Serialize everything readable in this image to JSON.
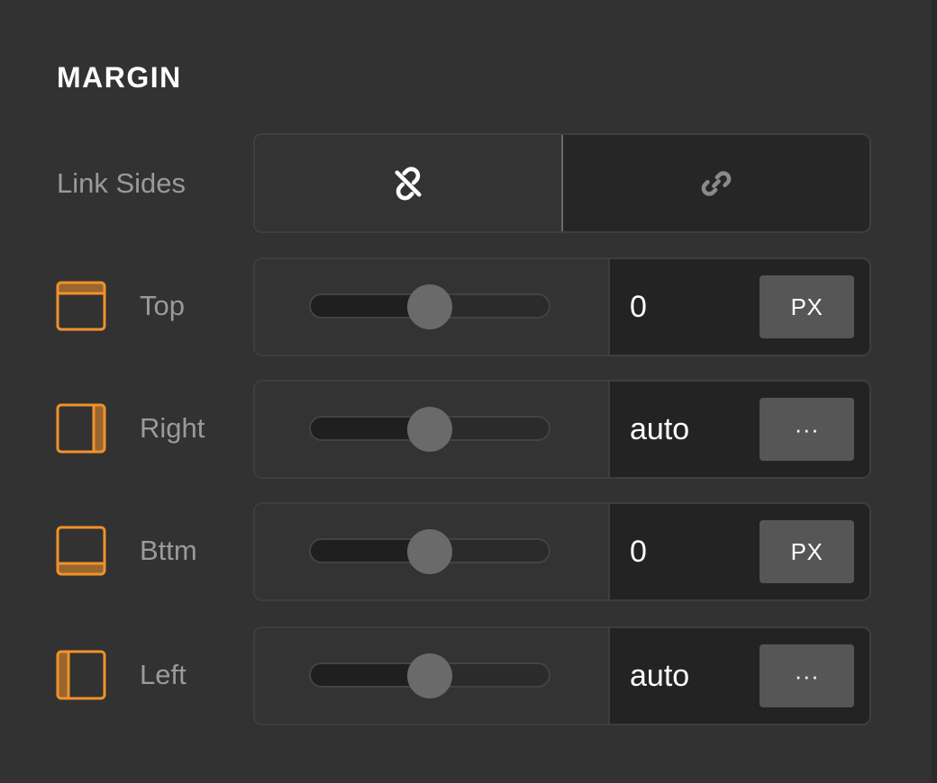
{
  "section": {
    "title": "MARGIN"
  },
  "link_sides": {
    "label": "Link Sides",
    "options": [
      {
        "icon": "unlink-icon",
        "active": true
      },
      {
        "icon": "link-icon",
        "active": false
      }
    ]
  },
  "sides": [
    {
      "key": "top",
      "label": "Top",
      "icon": "margin-top-icon",
      "value": "0",
      "unit": "PX",
      "slider": 0.5
    },
    {
      "key": "right",
      "label": "Right",
      "icon": "margin-right-icon",
      "value": "auto",
      "unit": "···",
      "slider": 0.5
    },
    {
      "key": "bottom",
      "label": "Bttm",
      "icon": "margin-bottom-icon",
      "value": "0",
      "unit": "PX",
      "slider": 0.5
    },
    {
      "key": "left",
      "label": "Left",
      "icon": "margin-left-icon",
      "value": "auto",
      "unit": "···",
      "slider": 0.5
    }
  ],
  "colors": {
    "accent": "#f0922b",
    "panel_bg": "#323232",
    "field_bg": "#232323",
    "unit_button": "#565656"
  }
}
